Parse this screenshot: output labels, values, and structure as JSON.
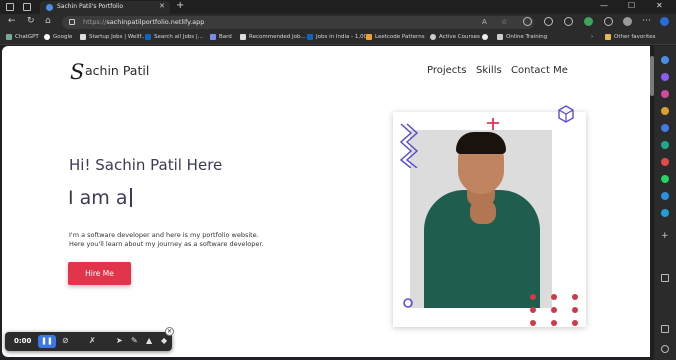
{
  "browser": {
    "tab_title": "Sachin Patil's Portfolio",
    "url_prefix": "https://",
    "url_host": "sachinpatilportfolio.netlify.app",
    "bookmarks": [
      "ChatGPT",
      "Google",
      "Startup Jobs | Wellf...",
      "Search all Jobs |...",
      "Bard",
      "Recommended Job...",
      "Jobs in India - 1,00...",
      "Leetcode Patterns",
      "Active Courses",
      "Online Training"
    ],
    "other_favorites": "Other favorites"
  },
  "site": {
    "logo_mark": "S",
    "logo_text": "achin Patil",
    "nav": [
      "Projects",
      "Skills",
      "Contact Me"
    ],
    "greeting": "Hi! Sachin Patil Here",
    "typing_text": "I am a",
    "description_line1": "I'm a software developer and here is my portfolio website.",
    "description_line2": "Here you'll learn about my journey as a software developer.",
    "cta": "Hire Me"
  },
  "recorder": {
    "time": "0:00"
  },
  "colors": {
    "accent": "#e0354b",
    "pattern_blue": "#5a4fcf",
    "shirt": "#1f5d4f"
  }
}
